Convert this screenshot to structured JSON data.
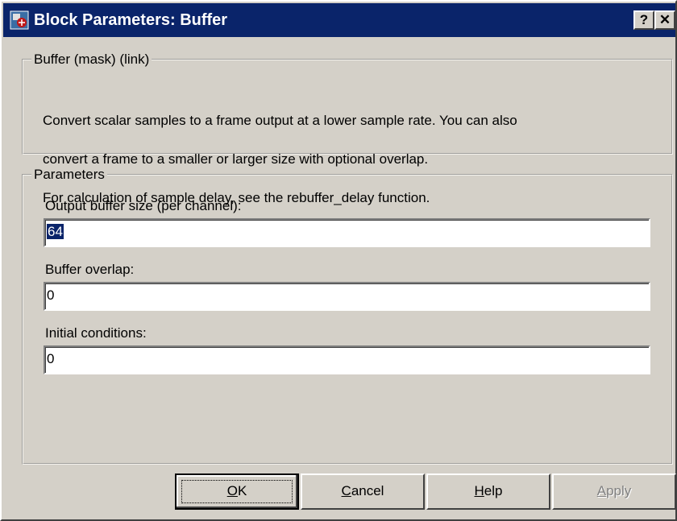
{
  "window": {
    "title": "Block Parameters: Buffer",
    "help_button": "?",
    "close_button": "✕"
  },
  "description_group": {
    "legend": "Buffer (mask) (link)",
    "lines": [
      "Convert scalar samples to a frame output at a lower sample rate.  You can also",
      "convert a frame to a smaller or larger size with optional overlap.",
      "For calculation of sample delay, see the rebuffer_delay function."
    ]
  },
  "parameters_group": {
    "legend": "Parameters",
    "fields": [
      {
        "label": "Output buffer size (per channel):",
        "value": "64",
        "selected": true
      },
      {
        "label": "Buffer overlap:",
        "value": "0",
        "selected": false
      },
      {
        "label": "Initial conditions:",
        "value": "0",
        "selected": false
      }
    ]
  },
  "buttons": {
    "ok": {
      "mnemonic": "O",
      "rest": "K"
    },
    "cancel": {
      "mnemonic": "C",
      "rest": "ancel"
    },
    "help": {
      "mnemonic": "H",
      "rest": "elp"
    },
    "apply": {
      "mnemonic": "A",
      "rest": "pply",
      "disabled": true
    }
  }
}
